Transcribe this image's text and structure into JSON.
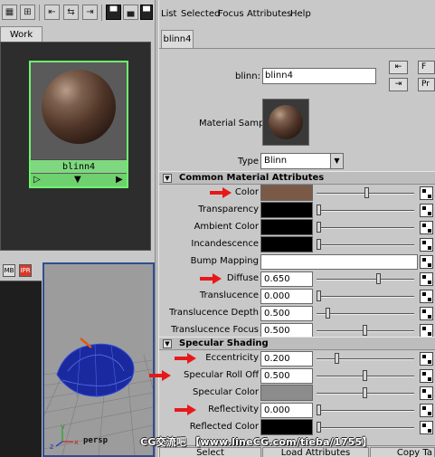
{
  "left_toolbar": {
    "icons": [
      "show-top-bottom-tabs-icon",
      "show-graph-icon",
      "graph-input-icon",
      "graph-input-output-icon",
      "graph-output-icon",
      "layout-top-tabs-icon",
      "layout-bottom-tabs-icon",
      "layout-both-icon"
    ]
  },
  "hypershade": {
    "work_tab": "Work Area",
    "swatch_name": "blinn4",
    "mini_labels": [
      "MB",
      "IPR"
    ]
  },
  "viewport": {
    "camera": "persp",
    "axes": {
      "x": "x",
      "y": "y",
      "z": "z"
    }
  },
  "menu": [
    "List",
    "Selected",
    "Focus",
    "Attributes",
    "Help"
  ],
  "attribute_editor": {
    "node_tab": "blinn4",
    "name_label": "blinn:",
    "name_value": "blinn4",
    "focus_buttons": [
      "input-connections-icon",
      "output-connections-icon"
    ],
    "edge_buttons": [
      "F",
      "Pr"
    ],
    "material_sample_label": "Material Sample",
    "type_label": "Type",
    "type_value": "Blinn",
    "common_section": "Common Material Attributes",
    "common": [
      {
        "label": "Color",
        "kind": "color",
        "color": "#7a5a47",
        "slider": 0.52,
        "highlighted": true
      },
      {
        "label": "Transparency",
        "kind": "color",
        "color": "#000000",
        "slider": 0.0
      },
      {
        "label": "Ambient Color",
        "kind": "color",
        "color": "#000000",
        "slider": 0.0
      },
      {
        "label": "Incandescence",
        "kind": "color",
        "color": "#000000",
        "slider": 0.0
      },
      {
        "label": "Bump Mapping",
        "kind": "map"
      },
      {
        "label": "Diffuse",
        "kind": "number",
        "value": "0.650",
        "slider": 0.65,
        "highlighted": true
      },
      {
        "label": "Translucence",
        "kind": "number",
        "value": "0.000",
        "slider": 0.0
      },
      {
        "label": "Translucence Depth",
        "kind": "number",
        "value": "0.500",
        "slider": 0.1
      },
      {
        "label": "Translucence Focus",
        "kind": "number",
        "value": "0.500",
        "slider": 0.5
      }
    ],
    "specular_section": "Specular Shading",
    "specular": [
      {
        "label": "Eccentricity",
        "kind": "number",
        "value": "0.200",
        "slider": 0.2,
        "highlighted": true
      },
      {
        "label": "Specular Roll Off",
        "kind": "number",
        "value": "0.500",
        "slider": 0.5,
        "highlighted": true
      },
      {
        "label": "Specular Color",
        "kind": "color",
        "color": "#8c8c8c",
        "slider": 0.5
      },
      {
        "label": "Reflectivity",
        "kind": "number",
        "value": "0.000",
        "slider": 0.0,
        "highlighted": true
      },
      {
        "label": "Reflected Color",
        "kind": "color",
        "color": "#000000",
        "slider": 0.0
      }
    ],
    "bottom_buttons": [
      "Select",
      "Load Attributes",
      "Copy Ta"
    ]
  },
  "watermark": "CG交流吧 【www.lineCG.com/tieba/1755】",
  "colors": {
    "accent_green": "#7fd87f",
    "arrow_red": "#e81818"
  }
}
